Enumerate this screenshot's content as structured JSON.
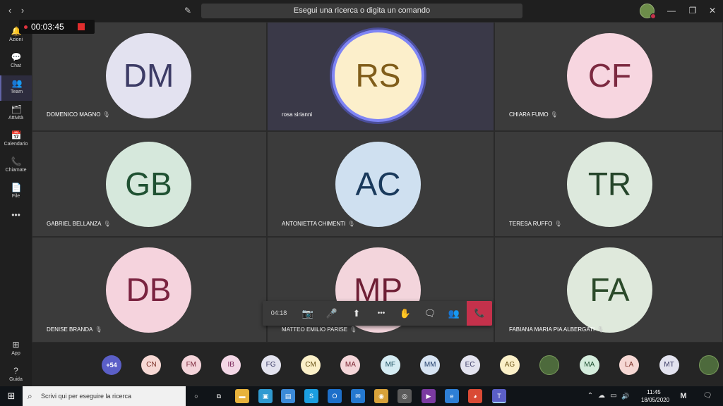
{
  "titlebar": {
    "search_text": "Esegui una ricerca o digita un comando",
    "back_icon": "‹",
    "forward_icon": "›",
    "compose_icon": "✎",
    "minimize_icon": "—",
    "restore_icon": "❐",
    "close_icon": "✕"
  },
  "recording": {
    "time": "00:03:45"
  },
  "rail": [
    {
      "label": "Azioni",
      "icon": "🔔"
    },
    {
      "label": "Chat",
      "icon": "💬"
    },
    {
      "label": "Team",
      "icon": "👥"
    },
    {
      "label": "Attività",
      "icon": "🗂"
    },
    {
      "label": "Calendario",
      "icon": "📅"
    },
    {
      "label": "Chiamate",
      "icon": "📞"
    },
    {
      "label": "File",
      "icon": "📄"
    },
    {
      "label": "",
      "icon": "•••"
    },
    {
      "label": "App",
      "icon": "⊞"
    },
    {
      "label": "Guida",
      "icon": "?"
    }
  ],
  "participants": [
    {
      "initials": "DM",
      "name": "DOMENICO MAGNO",
      "bg": "#e3e2f0",
      "fg": "#3d3c66"
    },
    {
      "initials": "RS",
      "name": "rosa sirianni",
      "bg": "#fcefcb",
      "fg": "#805d1a"
    },
    {
      "initials": "CF",
      "name": "CHIARA FUMO",
      "bg": "#f7d6e0",
      "fg": "#7c2940"
    },
    {
      "initials": "GB",
      "name": "GABRIEL BELLANZA",
      "bg": "#d6e8dc",
      "fg": "#1f5132"
    },
    {
      "initials": "AC",
      "name": "ANTONIETTA CHIMENTI",
      "bg": "#cfe0f0",
      "fg": "#1a3a5c"
    },
    {
      "initials": "TR",
      "name": "TERESA RUFFO",
      "bg": "#dde9dd",
      "fg": "#25452a"
    },
    {
      "initials": "DB",
      "name": "DENISE BRANDA",
      "bg": "#f5d3dd",
      "fg": "#7a2340"
    },
    {
      "initials": "MP",
      "name": "MATTEO EMILIO PARISE",
      "bg": "#f3d5dc",
      "fg": "#6e1f35"
    },
    {
      "initials": "FA",
      "name": "FABIANA MARIA PIA ALBERGATI",
      "bg": "#dfe9dc",
      "fg": "#2b4a2a"
    }
  ],
  "mic_icon": "🎙",
  "controls": {
    "time": "04:18",
    "camera_icon": "📷",
    "mic_icon": "🎤",
    "share_icon": "⬆",
    "more_icon": "•••",
    "hand_icon": "✋",
    "chat_icon": "🗨",
    "people_icon": "👥",
    "hangup_icon": "📞"
  },
  "roster": [
    {
      "label": "+54",
      "type": "more"
    },
    {
      "label": "CN",
      "bg": "#f6d8d4",
      "fg": "#7a2e24"
    },
    {
      "label": "FM",
      "bg": "#f4d4da",
      "fg": "#7a2538"
    },
    {
      "label": "IB",
      "bg": "#f3d7e6",
      "fg": "#7a2558"
    },
    {
      "label": "FG",
      "bg": "#e3e3ef",
      "fg": "#3b3b66"
    },
    {
      "label": "CM",
      "bg": "#fbf0c8",
      "fg": "#6b5418"
    },
    {
      "label": "MA",
      "bg": "#f4d6d9",
      "fg": "#7a2330"
    },
    {
      "label": "MF",
      "bg": "#d5ecf3",
      "fg": "#1f5364"
    },
    {
      "label": "MM",
      "bg": "#d7e4f3",
      "fg": "#1e3c6a"
    },
    {
      "label": "EC",
      "bg": "#e3e3ef",
      "fg": "#3b3b66"
    },
    {
      "label": "AG",
      "bg": "#fbf0c8",
      "fg": "#6b5418"
    },
    {
      "label": "",
      "type": "photo"
    },
    {
      "label": "MA",
      "bg": "#d4ecdc",
      "fg": "#1f5132"
    },
    {
      "label": "LA",
      "bg": "#f6d8d4",
      "fg": "#7a2e24"
    },
    {
      "label": "MT",
      "bg": "#e3e3ef",
      "fg": "#3b3b66"
    },
    {
      "label": "",
      "type": "photo"
    }
  ],
  "taskbar": {
    "start_icon": "⊞",
    "search_placeholder": "Scrivi qui per eseguire la ricerca",
    "search_icon": "⌕",
    "apps": [
      {
        "name": "cortana-icon",
        "glyph": "○",
        "bg": "transparent"
      },
      {
        "name": "task-view-icon",
        "glyph": "⧉",
        "bg": "transparent"
      },
      {
        "name": "file-explorer-icon",
        "glyph": "▬",
        "bg": "#e8b33c"
      },
      {
        "name": "store-icon",
        "glyph": "▣",
        "bg": "#2f9ad1"
      },
      {
        "name": "documents-icon",
        "glyph": "▤",
        "bg": "#3b8ad8"
      },
      {
        "name": "skype-icon",
        "glyph": "S",
        "bg": "#1b9ee0"
      },
      {
        "name": "outlook-icon",
        "glyph": "O",
        "bg": "#1d6fc9"
      },
      {
        "name": "mail-icon",
        "glyph": "✉",
        "bg": "#2478cf"
      },
      {
        "name": "chrome-alt-icon",
        "glyph": "◉",
        "bg": "#d8a23a"
      },
      {
        "name": "media-icon",
        "glyph": "◎",
        "bg": "#5a5a5a"
      },
      {
        "name": "video-editor-icon",
        "glyph": "▶",
        "bg": "#7b3aa1"
      },
      {
        "name": "edge-icon",
        "glyph": "e",
        "bg": "#2e7fd6"
      },
      {
        "name": "chrome-icon",
        "glyph": "◕",
        "bg": "#d94a35"
      },
      {
        "name": "teams-icon",
        "glyph": "T",
        "bg": "#5b5fc7"
      }
    ],
    "tray_icons": {
      "up": "⌃",
      "cloud": "☁",
      "network": "▭",
      "volume": "🔊"
    },
    "time": "11:45",
    "date": "18/05/2020",
    "notification_icon": "🗨"
  }
}
